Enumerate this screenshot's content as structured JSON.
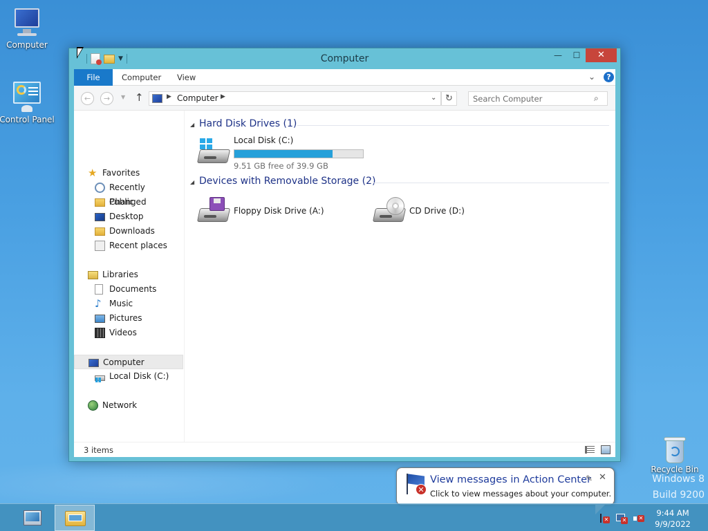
{
  "desktop": {
    "icons": [
      {
        "label": "Computer",
        "icon": "computer-icon"
      },
      {
        "label": "Control Panel",
        "icon": "control-panel-icon"
      }
    ],
    "recycle_bin_label": "Recycle Bin",
    "watermark": {
      "line1": "Windows 8",
      "line2": "Build 9200"
    }
  },
  "window": {
    "title": "Computer",
    "controls": {
      "minimize": "—",
      "maximize": "☐",
      "close": "✕"
    },
    "ribbon": {
      "tabs": [
        {
          "label": "File",
          "active": true
        },
        {
          "label": "Computer",
          "active": false
        },
        {
          "label": "View",
          "active": false
        }
      ],
      "expand_glyph": "⌄",
      "help_glyph": "?"
    },
    "address": {
      "location": "Computer",
      "search_placeholder": "Search Computer"
    },
    "nav_pane": {
      "favorites": {
        "label": "Favorites",
        "items": [
          "Recently Changed",
          "Public",
          "Desktop",
          "Downloads",
          "Recent places"
        ]
      },
      "libraries": {
        "label": "Libraries",
        "items": [
          "Documents",
          "Music",
          "Pictures",
          "Videos"
        ]
      },
      "computer": {
        "label": "Computer",
        "selected": true,
        "items": [
          "Local Disk (C:)"
        ]
      },
      "network": {
        "label": "Network"
      }
    },
    "groups": [
      {
        "title": "Hard Disk Drives (1)",
        "drives": [
          {
            "name": "Local Disk (C:)",
            "free_text": "9.51 GB free of 39.9 GB",
            "used_fraction": 0.762,
            "icon": "windows-hard-drive-icon"
          }
        ]
      },
      {
        "title": "Devices with Removable Storage (2)",
        "drives": [
          {
            "name": "Floppy Disk Drive (A:)",
            "icon": "floppy-drive-icon"
          },
          {
            "name": "CD Drive (D:)",
            "icon": "cd-drive-icon"
          }
        ]
      }
    ],
    "status": {
      "items_text": "3 items"
    },
    "colors": {
      "accent": "#1979ca",
      "usage_bar": "#26a0da",
      "frame": "#67c1d7",
      "close": "#c7453b"
    }
  },
  "notification": {
    "title": "View messages in Action Center",
    "body": "Click to view messages about your computer.",
    "close_glyph": "✕"
  },
  "taskbar": {
    "buttons": [
      {
        "name": "internet-explorer",
        "active": false
      },
      {
        "name": "file-explorer",
        "active": true
      }
    ],
    "clock": {
      "time": "9:44 AM",
      "date": "9/9/2022"
    }
  }
}
